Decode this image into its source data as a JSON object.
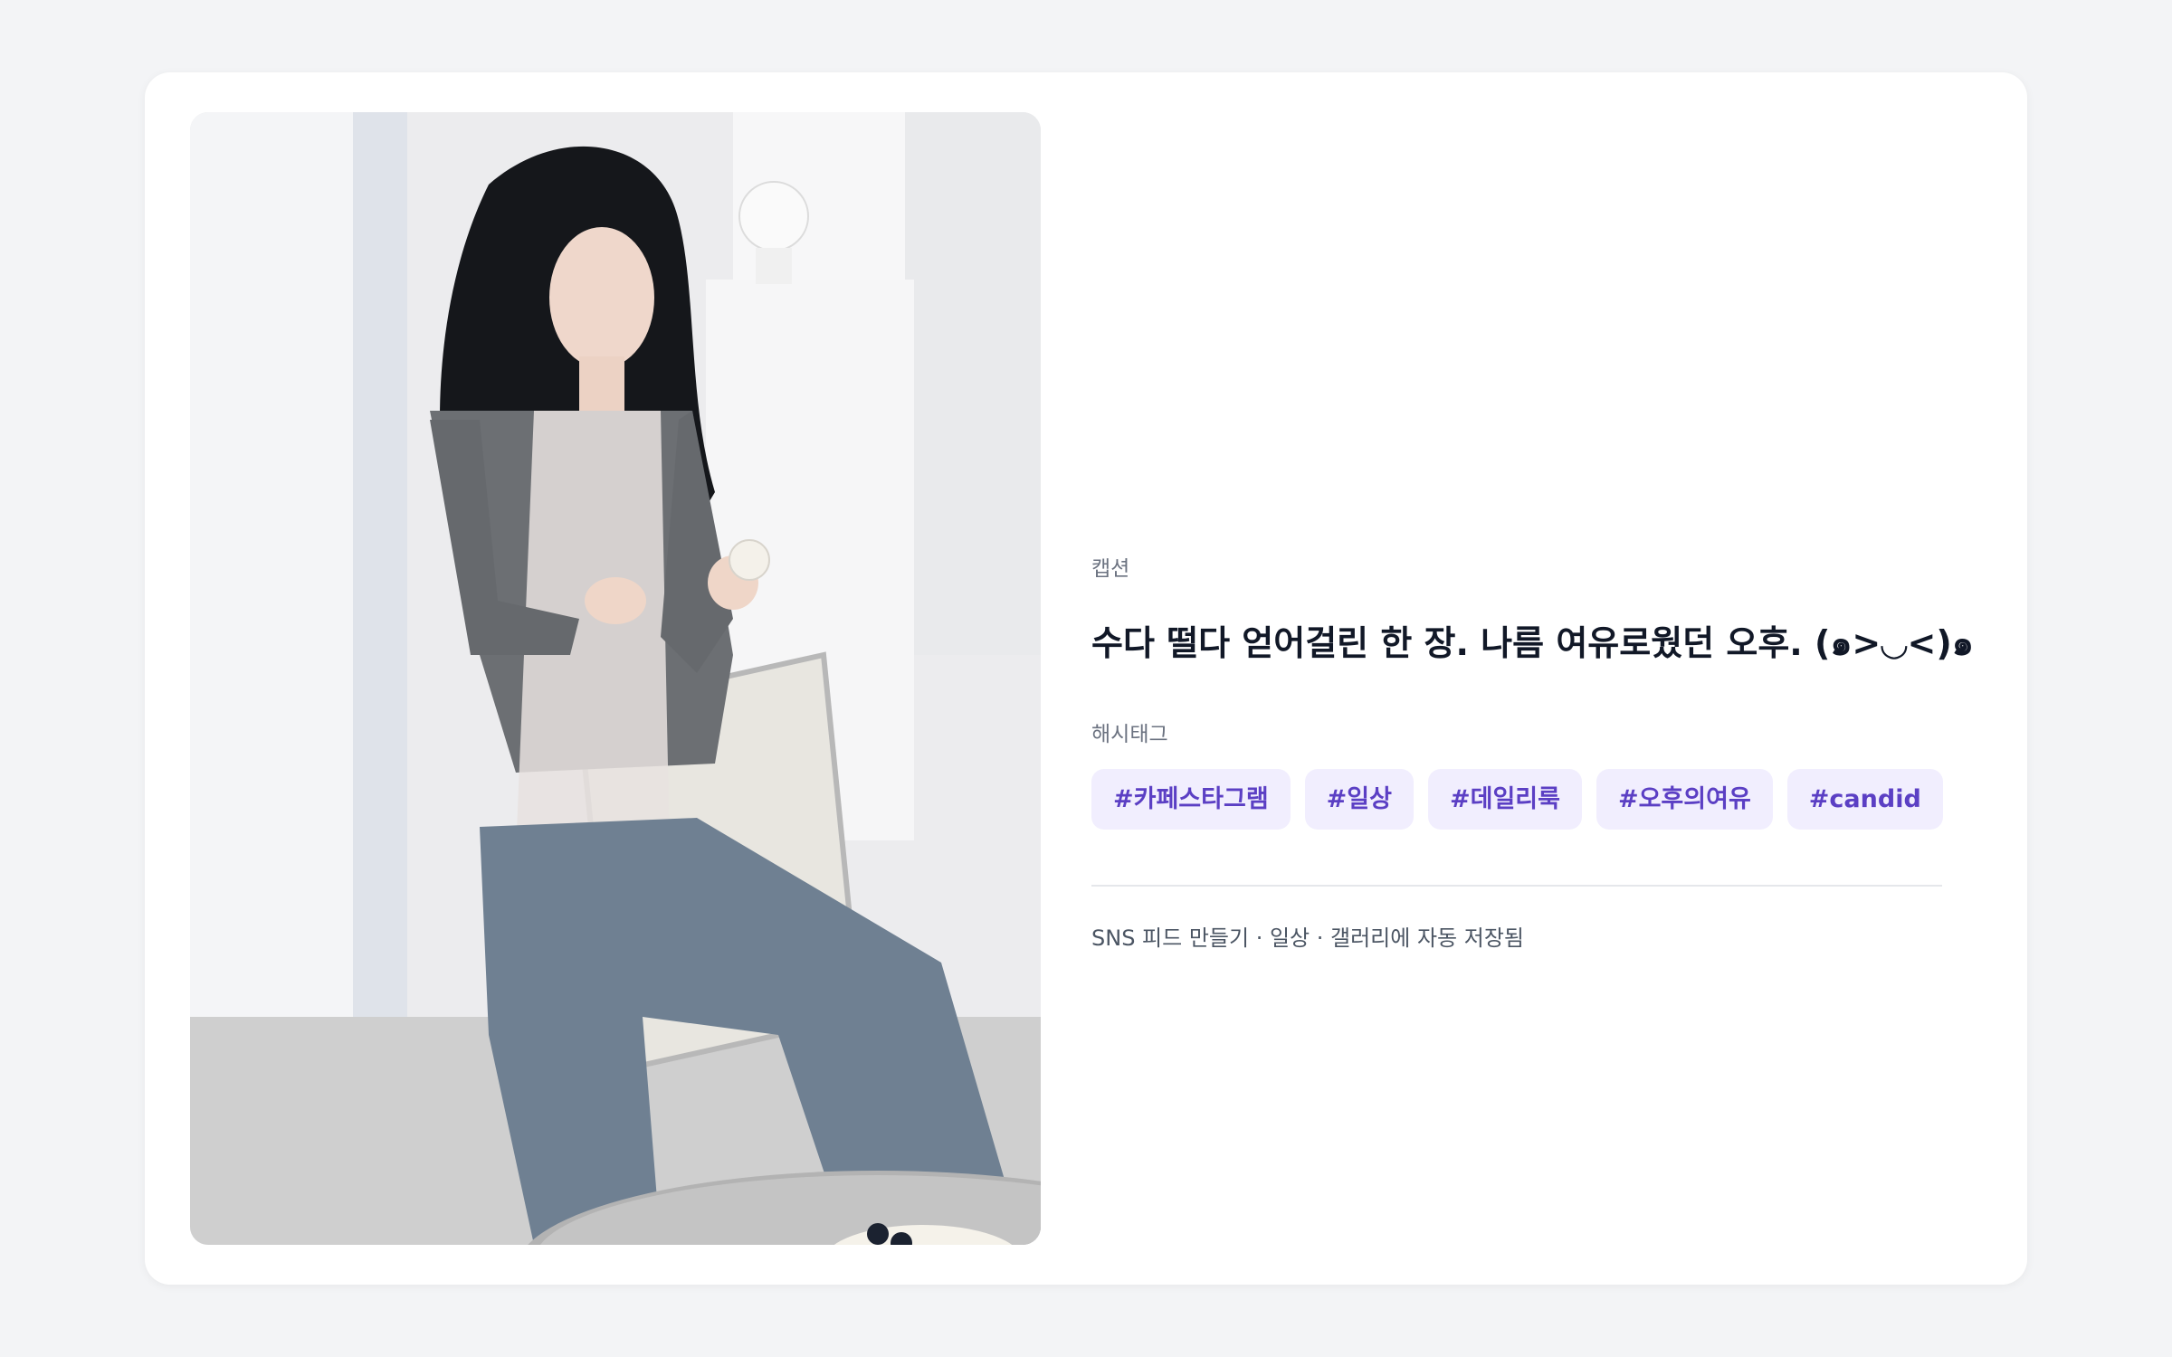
{
  "photo": {
    "alt": "photo-of-woman-eating-cake-in-cafe"
  },
  "caption": {
    "label": "캡션",
    "text": "수다 떨다 얻어걸린 한 장. 나름 여유로웠던 오후. (๑>◡<)๑"
  },
  "hashtags": {
    "label": "해시태그",
    "items": [
      "#카페스타그램",
      "#일상",
      "#데일리룩",
      "#오후의여유",
      "#candid"
    ]
  },
  "footer": {
    "note": "SNS 피드 만들기 · 일상 · 갤러리에 자동 저장됨"
  },
  "colors": {
    "page_bg": "#f3f4f6",
    "card_bg": "#ffffff",
    "tag_bg": "#f1eefe",
    "tag_text": "#5b3fc4",
    "text_primary": "#111827",
    "text_muted": "#6b7280"
  }
}
